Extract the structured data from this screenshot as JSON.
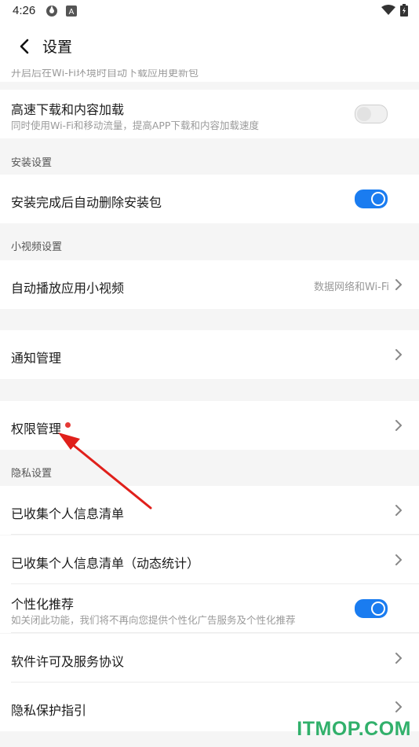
{
  "status_bar": {
    "time": "4:26",
    "icons": [
      "settings-app-icon",
      "a-icon",
      "wifi-icon",
      "battery-icon"
    ]
  },
  "header": {
    "title": "设置"
  },
  "top_peek": {
    "text": "开启后在Wi-Fi环境时自动下载应用更新包"
  },
  "rows": {
    "hispeed": {
      "label": "高速下载和内容加载",
      "sub": "同时使用Wi-Fi和移动流量，提高APP下载和内容加载速度",
      "toggle": "off"
    },
    "install_section": "安装设置",
    "auto_delete": {
      "label": "安装完成后自动删除安装包",
      "toggle": "on"
    },
    "video_section": "小视频设置",
    "autoplay": {
      "label": "自动播放应用小视频",
      "value": "数据网络和Wi-Fi"
    },
    "notify": {
      "label": "通知管理"
    },
    "permission": {
      "label": "权限管理"
    },
    "privacy_section": "隐私设置",
    "collected": {
      "label": "已收集个人信息清单"
    },
    "collected_dynamic": {
      "label": "已收集个人信息清单（动态统计）"
    },
    "personalized": {
      "label": "个性化推荐",
      "sub": "如关闭此功能，我们将不再向您提供个性化广告服务及个性化推荐",
      "toggle": "on"
    },
    "license": {
      "label": "软件许可及服务协议"
    },
    "privacy_guide": {
      "label": "隐私保护指引"
    }
  },
  "watermark": "ITMOP.COM",
  "colors": {
    "accent": "#1a7cf0",
    "annotation": "#e0201b",
    "watermark": "#31b06b"
  }
}
